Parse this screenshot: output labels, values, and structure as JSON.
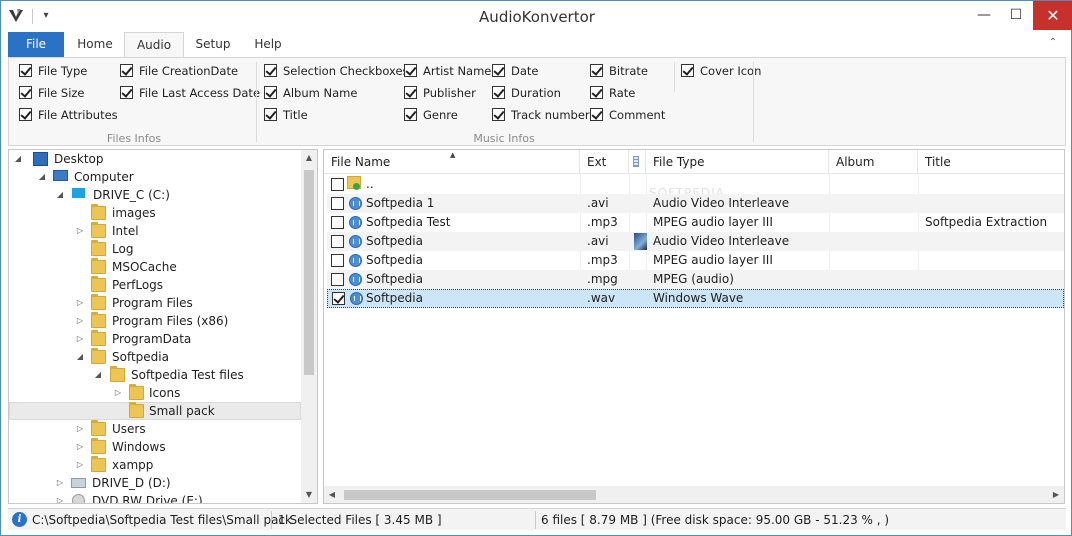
{
  "window": {
    "title": "AudioKonvertor"
  },
  "window_controls": {
    "minimize": "—",
    "maximize": "☐",
    "close": "✕"
  },
  "qa": {
    "dropdown": "▾"
  },
  "ribbon_tabs": [
    "File",
    "Home",
    "Audio",
    "Setup",
    "Help"
  ],
  "ribbon_collapse": "⌃",
  "files_infos": {
    "label": "Files Infos",
    "items": [
      {
        "label": "File Type",
        "checked": true
      },
      {
        "label": "File Size",
        "checked": true
      },
      {
        "label": "File Attributes",
        "checked": true
      },
      {
        "label": "File CreationDate",
        "checked": true
      },
      {
        "label": "File Last Access Date",
        "checked": true
      }
    ]
  },
  "music_infos": {
    "label": "Music Infos",
    "items": [
      {
        "label": "Selection Checkboxes",
        "checked": true
      },
      {
        "label": "Album Name",
        "checked": true
      },
      {
        "label": "Title",
        "checked": true
      },
      {
        "label": "Artist Name",
        "checked": true
      },
      {
        "label": "Publisher",
        "checked": true
      },
      {
        "label": "Genre",
        "checked": true
      },
      {
        "label": "Date",
        "checked": true
      },
      {
        "label": "Duration",
        "checked": true
      },
      {
        "label": "Track number",
        "checked": true
      },
      {
        "label": "Bitrate",
        "checked": true
      },
      {
        "label": "Rate",
        "checked": true
      },
      {
        "label": "Comment",
        "checked": true
      },
      {
        "label": "Cover Icon",
        "checked": true
      }
    ]
  },
  "tree": {
    "items": [
      {
        "label": "Desktop",
        "icon": "desktop",
        "expander": "◢"
      },
      {
        "label": "Computer",
        "icon": "computer",
        "expander": "◢"
      },
      {
        "label": "DRIVE_C (C:)",
        "icon": "drive",
        "expander": "◢"
      },
      {
        "label": "images",
        "icon": "folder",
        "expander": ""
      },
      {
        "label": "Intel",
        "icon": "folder",
        "expander": "▷"
      },
      {
        "label": "Log",
        "icon": "folder",
        "expander": ""
      },
      {
        "label": "MSOCache",
        "icon": "folder",
        "expander": ""
      },
      {
        "label": "PerfLogs",
        "icon": "folder",
        "expander": ""
      },
      {
        "label": "Program Files",
        "icon": "folder",
        "expander": "▷"
      },
      {
        "label": "Program Files (x86)",
        "icon": "folder",
        "expander": "▷"
      },
      {
        "label": "ProgramData",
        "icon": "folder",
        "expander": "▷"
      },
      {
        "label": "Softpedia",
        "icon": "folder",
        "expander": "◢"
      },
      {
        "label": "Softpedia Test files",
        "icon": "folder",
        "expander": "◢"
      },
      {
        "label": "Icons",
        "icon": "folder",
        "expander": "▷"
      },
      {
        "label": "Small pack",
        "icon": "folder",
        "expander": "",
        "selected": true
      },
      {
        "label": "Users",
        "icon": "folder",
        "expander": "▷"
      },
      {
        "label": "Windows",
        "icon": "folder",
        "expander": "▷"
      },
      {
        "label": "xampp",
        "icon": "folder",
        "expander": "▷"
      },
      {
        "label": "DRIVE_D (D:)",
        "icon": "drive",
        "expander": "▷"
      },
      {
        "label": "DVD RW Drive (E:)",
        "icon": "dvd",
        "expander": "▷"
      }
    ]
  },
  "scroll_arrows": {
    "up": "▲",
    "down": "▼",
    "left": "◀",
    "right": "▶"
  },
  "list": {
    "sort_indicator": "▲",
    "columns": [
      "File Name",
      "Ext",
      "",
      "File Type",
      "Album",
      "Title"
    ],
    "watermark": "SOFTPEDIA",
    "rows": [
      {
        "name": "..",
        "ext": "",
        "type": "",
        "album": "",
        "title": "",
        "checked": false,
        "icon": "folder-up",
        "cover": false
      },
      {
        "name": "Softpedia 1",
        "ext": ".avi",
        "type": "Audio Video Interleave",
        "album": "",
        "title": "",
        "checked": false,
        "icon": "audio",
        "cover": false
      },
      {
        "name": "Softpedia Test",
        "ext": ".mp3",
        "type": "MPEG audio layer III",
        "album": "",
        "title": "Softpedia Extraction",
        "checked": false,
        "icon": "audio",
        "cover": false
      },
      {
        "name": "Softpedia",
        "ext": ".avi",
        "type": "Audio Video Interleave",
        "album": "",
        "title": "",
        "checked": false,
        "icon": "audio",
        "cover": true
      },
      {
        "name": "Softpedia",
        "ext": ".mp3",
        "type": "MPEG audio layer III",
        "album": "",
        "title": "",
        "checked": false,
        "icon": "audio",
        "cover": false
      },
      {
        "name": "Softpedia",
        "ext": ".mpg",
        "type": "MPEG (audio)",
        "album": "",
        "title": "",
        "checked": false,
        "icon": "audio",
        "cover": false
      },
      {
        "name": "Softpedia",
        "ext": ".wav",
        "type": "Windows Wave",
        "album": "",
        "title": "",
        "checked": true,
        "icon": "audio",
        "cover": false,
        "selected": true
      }
    ]
  },
  "status": {
    "info_icon": "i",
    "path": "C:\\Softpedia\\Softpedia Test files\\Small pack",
    "selected": "1 Selected Files  [ 3.45 MB ]",
    "summary": "6 files [ 8.79 MB ]  (Free disk space: 95.00 GB  -  51.23 % , )"
  }
}
